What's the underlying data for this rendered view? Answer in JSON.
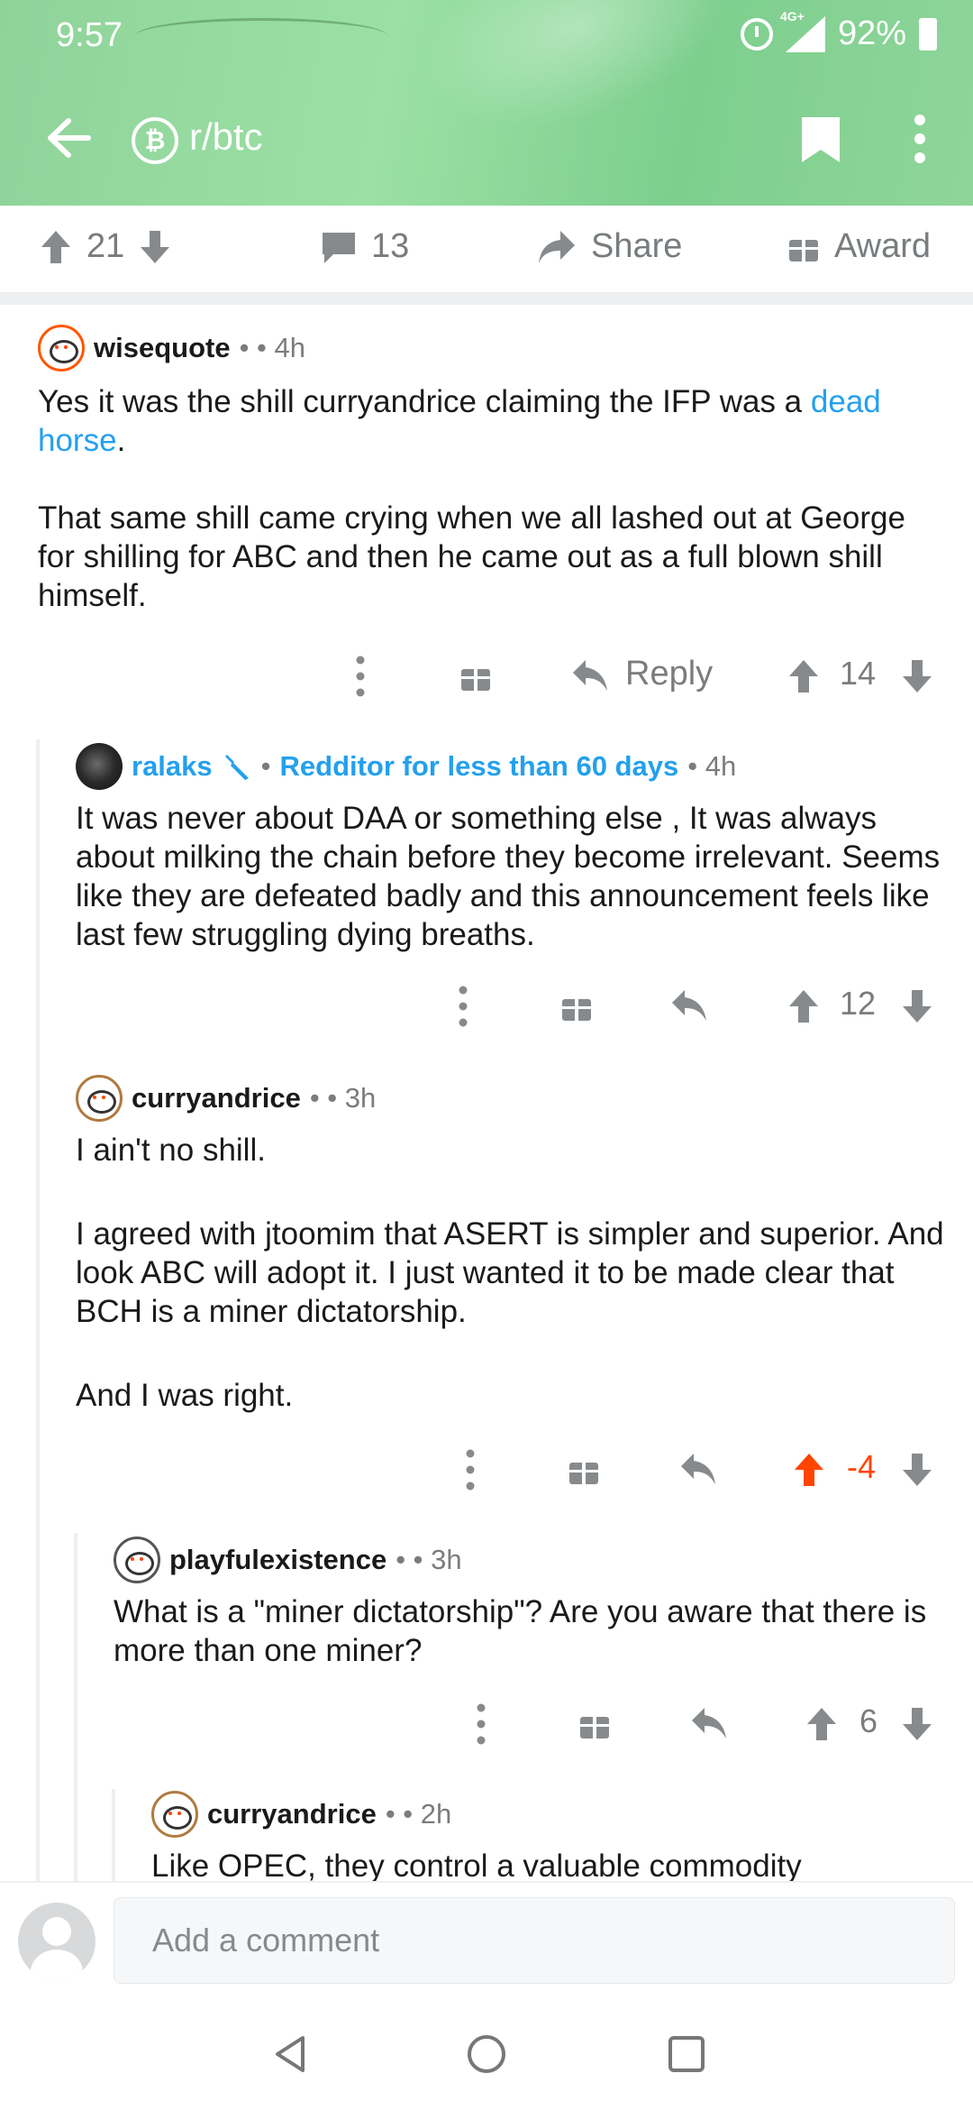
{
  "status": {
    "time": "9:57",
    "network": "4G+",
    "battery": "92%"
  },
  "nav": {
    "subreddit": "r/btc",
    "subreddit_icon": "bitcoin-icon"
  },
  "post_actions": {
    "upvotes": "21",
    "comments": "13",
    "share": "Share",
    "award": "Award"
  },
  "comments": [
    {
      "author": "wisequote",
      "sep": "• • 4h",
      "body_p1_a": "Yes it was the shill curryandrice claiming the IFP was a ",
      "link1": "dead",
      "link2": "horse",
      "body_p1_end": ".",
      "body_p2": "That same shill came crying when we all lashed out at George for shilling for ABC and then he came out as a full blown shill himself.",
      "reply": "Reply",
      "score": "14"
    },
    {
      "author": "ralaks",
      "flair": "Redditor for less than 60 days",
      "time": "• 4h",
      "body": "It was never about DAA or something else , It was always about milking the chain before they become irrelevant. Seems like they are defeated badly and this announcement feels like last few struggling dying breaths.",
      "score": "12"
    },
    {
      "author": "curryandrice",
      "sep": "• • 3h",
      "body_p1": "I ain't no shill.",
      "body_p2": "I agreed with jtoomim that ASERT is simpler and superior. And look ABC will adopt it. I just wanted it to be made clear that BCH is a miner dictatorship.",
      "body_p3": "And I was right.",
      "score": "-4"
    },
    {
      "author": "playfulexistence",
      "sep": "• • 3h",
      "body": "What is a \"miner dictatorship\"? Are you aware that there is more than one miner?",
      "score": "6"
    },
    {
      "author": "curryandrice",
      "sep": "• • 2h",
      "body": "Like OPEC, they control a valuable commodity"
    }
  ],
  "composer": {
    "placeholder": "Add a comment"
  },
  "colors": {
    "header": "#8fd39a",
    "link": "#24a0ed",
    "upvoted": "#ff4500",
    "icon_gray": "#787c7e"
  }
}
